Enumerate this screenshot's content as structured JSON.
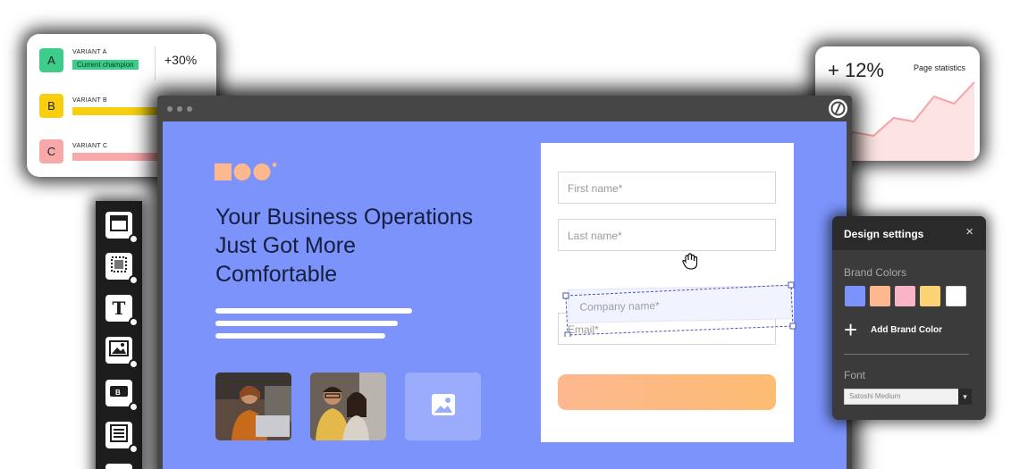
{
  "variants": {
    "lift": "+30%",
    "items": [
      {
        "letter": "A",
        "name": "VARIANT A",
        "tag": "Current champion",
        "color": "#3dcc8a"
      },
      {
        "letter": "B",
        "name": "VARIANT B",
        "color": "#f7cf10"
      },
      {
        "letter": "C",
        "name": "VARIANT C",
        "color": "#f9a8aa"
      }
    ]
  },
  "stats": {
    "percent": "+ 12%",
    "label": "Page statistics",
    "trend_values": [
      2,
      3,
      2.5,
      5,
      4.5,
      8,
      7,
      10
    ]
  },
  "hero": {
    "headline": "Your Business Operations Just Got More Comfortable"
  },
  "form": {
    "first_name_placeholder": "First name*",
    "last_name_placeholder": "Last name*",
    "company_placeholder": "Company name*",
    "email_placeholder": "Email*"
  },
  "toolbar": {
    "tools": [
      "section-icon",
      "box-icon",
      "text-icon",
      "image-icon",
      "button-icon",
      "form-icon"
    ]
  },
  "design_settings": {
    "title": "Design settings",
    "close": "×",
    "brand_colors_label": "Brand Colors",
    "brand_colors": [
      "#7b93fb",
      "#fdb88f",
      "#f9b4c8",
      "#fcd276",
      "#ffffff"
    ],
    "add_brand_color": "Add Brand Color",
    "font_label": "Font",
    "font_value": "Satoshi Medium"
  },
  "colors": {
    "viewport": "#7b93fb",
    "headline": "#171e3c",
    "accent_orange": "#fdb88f"
  }
}
